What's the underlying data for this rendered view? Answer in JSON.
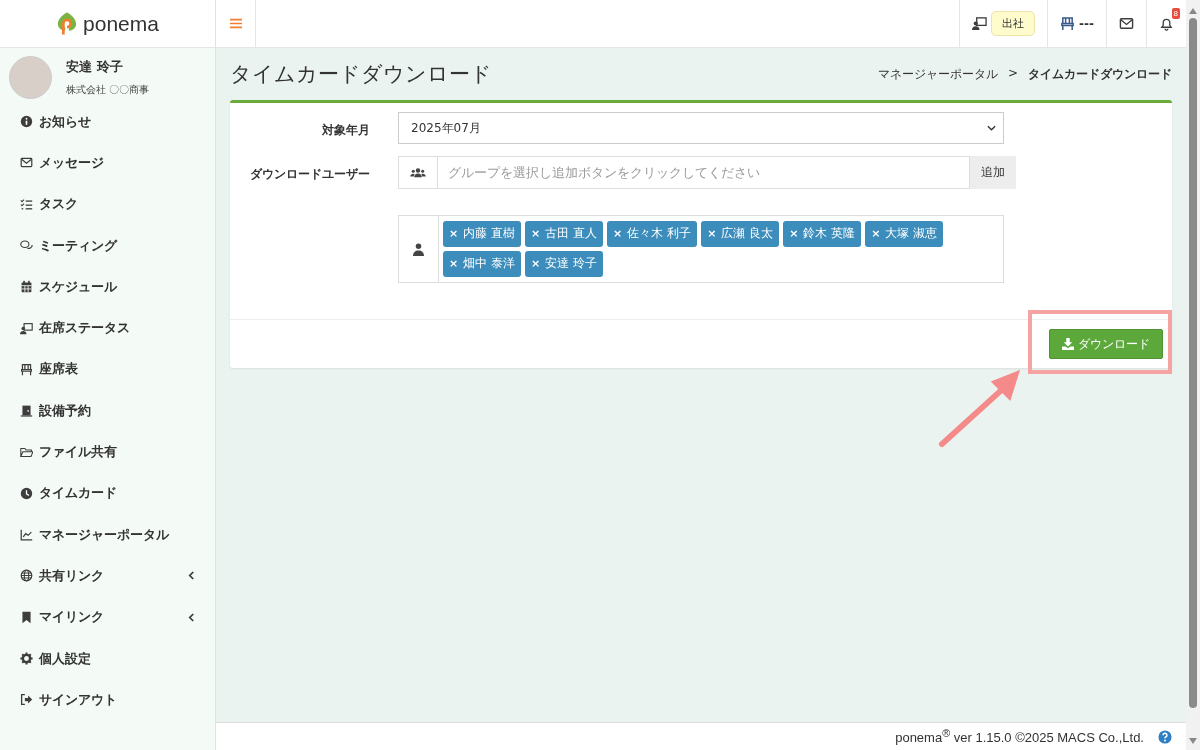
{
  "brand": {
    "name": "ponema"
  },
  "header": {
    "status_label": "出社",
    "seat_label": "---",
    "notification_count": "8"
  },
  "user": {
    "name": "安達 玲子",
    "company": "株式会社 〇〇商事"
  },
  "sidebar": {
    "items": [
      {
        "label": "お知らせ",
        "has_submenu": false
      },
      {
        "label": "メッセージ",
        "has_submenu": false
      },
      {
        "label": "タスク",
        "has_submenu": false
      },
      {
        "label": "ミーティング",
        "has_submenu": false
      },
      {
        "label": "スケジュール",
        "has_submenu": false
      },
      {
        "label": "在席ステータス",
        "has_submenu": false
      },
      {
        "label": "座席表",
        "has_submenu": false
      },
      {
        "label": "設備予約",
        "has_submenu": false
      },
      {
        "label": "ファイル共有",
        "has_submenu": false
      },
      {
        "label": "タイムカード",
        "has_submenu": false
      },
      {
        "label": "マネージャーポータル",
        "has_submenu": false
      },
      {
        "label": "共有リンク",
        "has_submenu": true
      },
      {
        "label": "マイリンク",
        "has_submenu": true
      },
      {
        "label": "個人設定",
        "has_submenu": false
      },
      {
        "label": "サインアウト",
        "has_submenu": false
      }
    ]
  },
  "page": {
    "title": "タイムカードダウンロード",
    "breadcrumb": [
      "マネージャーポータル",
      ">",
      "タイムカードダウンロード"
    ]
  },
  "form": {
    "month_label": "対象年月",
    "month_value": "2025年07月",
    "users_label": "ダウンロードユーザー",
    "group_placeholder": "グループを選択し追加ボタンをクリックしてください",
    "add_button": "追加",
    "users": [
      "内藤 直樹",
      "古田 直人",
      "佐々木 利子",
      "広瀬 良太",
      "鈴木 英隆",
      "大塚 淑恵",
      "畑中 泰洋",
      "安達 玲子"
    ],
    "remove_mark": "×",
    "download_button": "ダウンロード"
  },
  "footer": {
    "text": "ponema$^{®}$ ver 1.15.0 ©2025 MACS Co.,Ltd."
  }
}
